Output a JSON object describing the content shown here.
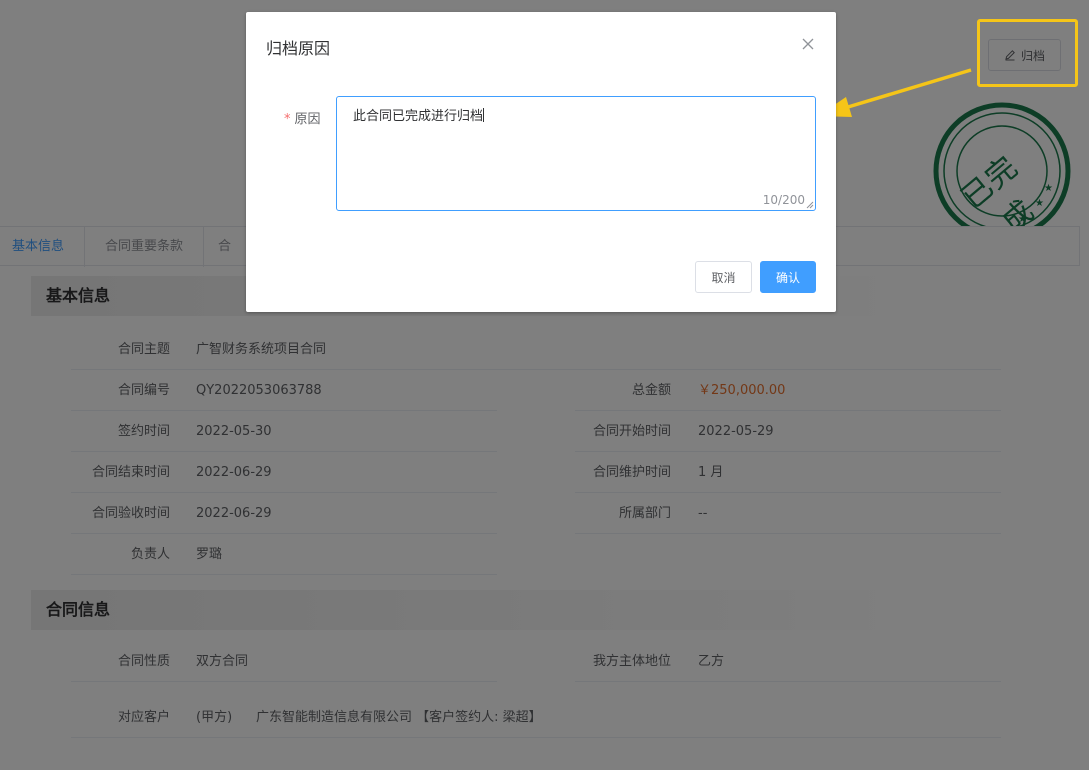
{
  "header": {
    "title_partial": "",
    "archive_button_label": "归档"
  },
  "stamp": {
    "text": "已完成"
  },
  "tabs": [
    {
      "label": "基本信息"
    },
    {
      "label": "合同重要条款"
    },
    {
      "label": "合"
    }
  ],
  "sections": {
    "basic_title": "基本信息",
    "contract_title": "合同信息"
  },
  "basic_info": {
    "subject_label": "合同主题",
    "subject_value": "广智财务系统项目合同",
    "number_label": "合同编号",
    "number_value": "QY2022053063788",
    "total_label": "总金额",
    "total_value": "￥250,000.00",
    "sign_label": "签约时间",
    "sign_value": "2022-05-30",
    "start_label": "合同开始时间",
    "start_value": "2022-05-29",
    "end_label": "合同结束时间",
    "end_value": "2022-06-29",
    "maint_label": "合同维护时间",
    "maint_value": "1 月",
    "accept_label": "合同验收时间",
    "accept_value": "2022-06-29",
    "dept_label": "所属部门",
    "dept_value": "--",
    "owner_label": "负责人",
    "owner_value": "罗璐"
  },
  "contract_info": {
    "nature_label": "合同性质",
    "nature_value": "双方合同",
    "position_label": "我方主体地位",
    "position_value": "乙方",
    "customer_label": "对应客户",
    "customer_party": "(甲方)",
    "customer_value": "广东智能制造信息有限公司 【客户签约人: 梁超】"
  },
  "dialog": {
    "title": "归档原因",
    "field_label": "原因",
    "required_mark": "*",
    "reason_value": "此合同已完成进行归档",
    "counter": "10/200",
    "cancel_label": "取消",
    "confirm_label": "确认"
  },
  "colors": {
    "primary": "#409eff",
    "highlight": "#f5c518",
    "stamp": "#1b7a4c",
    "money": "#e6702e",
    "required": "#f56c6c"
  }
}
